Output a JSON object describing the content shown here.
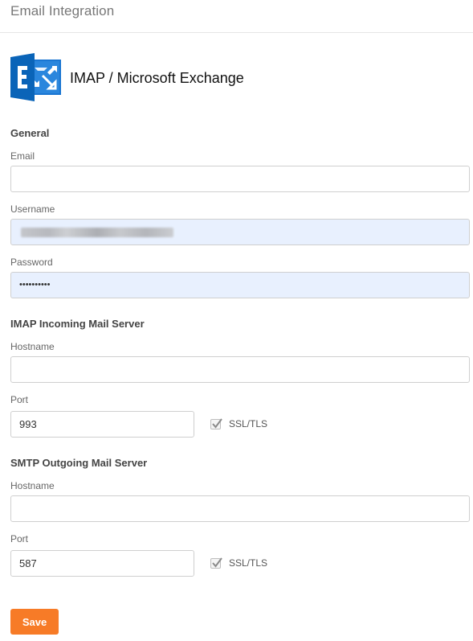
{
  "page": {
    "title": "Email Integration"
  },
  "provider": {
    "title": "IMAP / Microsoft Exchange",
    "logo_icon": "exchange-logo-icon",
    "brand_color": "#0072c6"
  },
  "general": {
    "title": "General",
    "email": {
      "label": "Email",
      "value": "",
      "placeholder": ""
    },
    "username": {
      "label": "Username",
      "value": ""
    },
    "password": {
      "label": "Password",
      "value": "••••••••••"
    }
  },
  "imap": {
    "title": "IMAP Incoming Mail Server",
    "hostname": {
      "label": "Hostname",
      "value": ""
    },
    "port": {
      "label": "Port",
      "value": "993"
    },
    "ssl": {
      "label": "SSL/TLS",
      "checked": true
    }
  },
  "smtp": {
    "title": "SMTP Outgoing Mail Server",
    "hostname": {
      "label": "Hostname",
      "value": ""
    },
    "port": {
      "label": "Port",
      "value": "587"
    },
    "ssl": {
      "label": "SSL/TLS",
      "checked": true
    }
  },
  "actions": {
    "save_label": "Save",
    "save_color": "#f77b27"
  }
}
